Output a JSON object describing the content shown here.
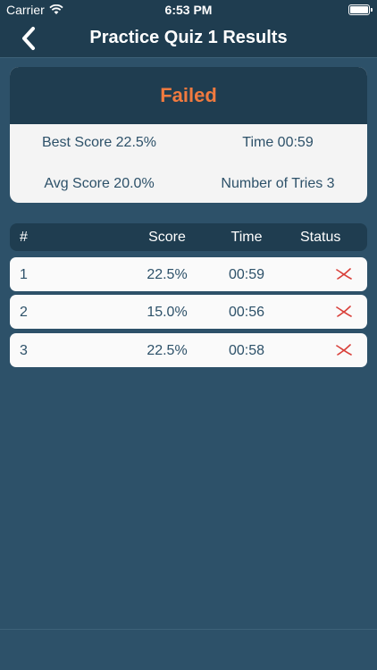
{
  "status_bar": {
    "carrier": "Carrier",
    "time": "6:53 PM"
  },
  "nav": {
    "title": "Practice Quiz 1 Results",
    "back_icon": "chevron-left-icon"
  },
  "summary": {
    "result": "Failed",
    "result_color": "#f07a3f",
    "best_score": "Best Score 22.5%",
    "time": "Time 00:59",
    "avg_score": "Avg Score 20.0%",
    "tries": "Number of Tries 3"
  },
  "table": {
    "headers": {
      "num": "#",
      "score": "Score",
      "time": "Time",
      "status": "Status"
    },
    "rows": [
      {
        "num": "1",
        "score": "22.5%",
        "time": "00:59",
        "status_icon": "x-mark-icon"
      },
      {
        "num": "2",
        "score": "15.0%",
        "time": "00:56",
        "status_icon": "x-mark-icon"
      },
      {
        "num": "3",
        "score": "22.5%",
        "time": "00:58",
        "status_icon": "x-mark-icon"
      }
    ]
  },
  "colors": {
    "background": "#2d5169",
    "header": "#1f3d50",
    "fail": "#d9403a"
  }
}
